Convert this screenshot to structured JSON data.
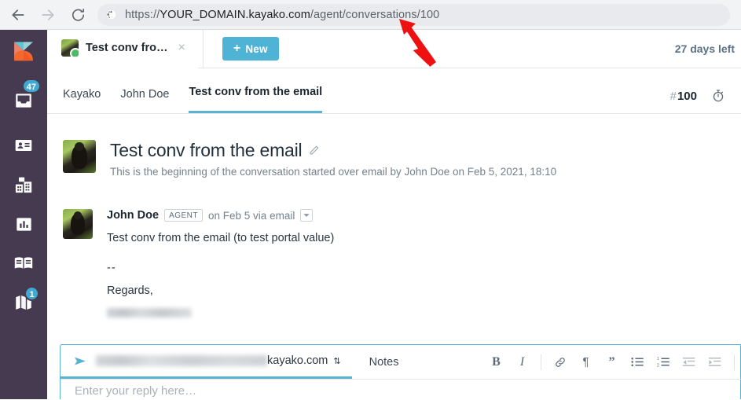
{
  "browser": {
    "back_icon": "back-arrow-icon",
    "forward_icon": "forward-arrow-icon",
    "reload_icon": "reload-icon",
    "site_icon": "globe-icon",
    "url_scheme": "https://",
    "url_host": "YOUR_DOMAIN.kayako.com",
    "url_path": "/agent/conversations/100",
    "url_full": "https://YOUR_DOMAIN.kayako.com/agent/conversations/100"
  },
  "rail": {
    "logo_name": "kayako-logo",
    "items": [
      {
        "name": "inbox-icon",
        "badge": "47"
      },
      {
        "name": "contacts-icon",
        "badge": ""
      },
      {
        "name": "organizations-icon",
        "badge": ""
      },
      {
        "name": "reports-icon",
        "badge": ""
      },
      {
        "name": "knowledgebase-icon",
        "badge": ""
      },
      {
        "name": "guides-icon",
        "badge": "1"
      }
    ]
  },
  "tabstrip": {
    "conversation_tab_label": "Test conv fro…",
    "close_label": "×",
    "new_button_plus": "+",
    "new_button_label": "New",
    "trial_notice": "27 days left"
  },
  "subnav": {
    "tabs": [
      {
        "label": "Kayako",
        "active": false
      },
      {
        "label": "John Doe",
        "active": false
      },
      {
        "label": "Test conv from the email",
        "active": true
      }
    ],
    "conversation_hash": "#",
    "conversation_number": "100",
    "timer_icon": "stopwatch-icon"
  },
  "conversation": {
    "avatar_name": "dog-photo-avatar",
    "title": "Test conv from the email",
    "edit_icon": "pencil-icon",
    "subtitle": "This is the beginning of the conversation started over email by John Doe on Feb 5, 2021, 18:10"
  },
  "message": {
    "avatar_name": "dog-photo-avatar",
    "author": "John Doe",
    "role_badge": "AGENT",
    "channel_meta": "on Feb 5 via email",
    "dropdown_icon": "chevron-down-icon",
    "body_line_1": "Test conv from the email (to test portal value)",
    "body_line_2": "--",
    "body_line_3": "Regards,",
    "signature_redacted": true
  },
  "composer": {
    "send_icon": "send-arrow-icon",
    "channel_address_visible": "kayako.com",
    "channel_address_redacted": true,
    "channel_caret": "⇅",
    "notes_tab_label": "Notes",
    "placeholder": "Enter your reply here…",
    "toolbar": [
      {
        "name": "bold-button",
        "glyph": "B"
      },
      {
        "name": "italic-button",
        "glyph": "I"
      },
      {
        "name": "link-button",
        "glyph": "link-icon"
      },
      {
        "name": "paragraph-button",
        "glyph": "¶"
      },
      {
        "name": "blockquote-button",
        "glyph": "”"
      },
      {
        "name": "bulleted-list-button",
        "glyph": "bullet-list-icon"
      },
      {
        "name": "numbered-list-button",
        "glyph": "numbered-list-icon"
      },
      {
        "name": "outdent-button",
        "glyph": "outdent-icon"
      },
      {
        "name": "indent-button",
        "glyph": "indent-icon"
      }
    ]
  },
  "annotation": {
    "arrow_color": "#ee1111",
    "arrow_points_to": "url-bar-end"
  },
  "colors": {
    "rail_bg": "#453a4f",
    "accent": "#5bb3d4",
    "badge": "#3fa9d1",
    "chrome_bg": "#f1f3f4"
  }
}
